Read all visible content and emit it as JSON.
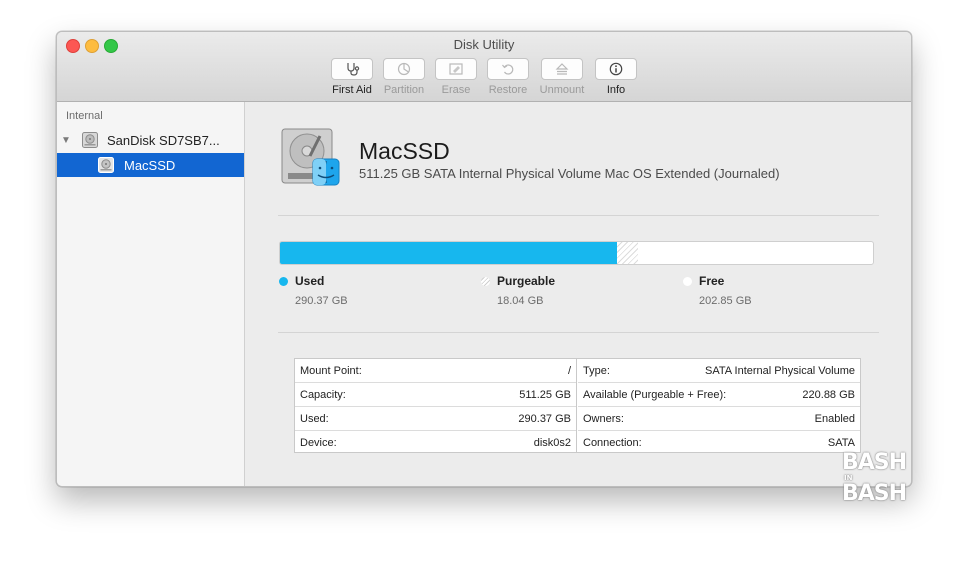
{
  "window": {
    "title": "Disk Utility"
  },
  "toolbar": {
    "first_aid": "First Aid",
    "partition": "Partition",
    "erase": "Erase",
    "restore": "Restore",
    "unmount": "Unmount",
    "info": "Info"
  },
  "sidebar": {
    "section": "Internal",
    "disk": "SanDisk SD7SB7...",
    "volume": "MacSSD"
  },
  "volume": {
    "name": "MacSSD",
    "description": "511.25 GB SATA Internal Physical Volume Mac OS Extended (Journaled)"
  },
  "usage": {
    "capacity_gb": 511.25,
    "used_gb": 290.37,
    "purgeable_gb": 18.04,
    "free_gb": 202.85,
    "colors": {
      "used": "#17b7ee",
      "purgeable": "#dcdcdc",
      "free": "#ffffff"
    },
    "legend": {
      "used_label": "Used",
      "used_value": "290.37 GB",
      "purgeable_label": "Purgeable",
      "purgeable_value": "18.04 GB",
      "free_label": "Free",
      "free_value": "202.85 GB"
    }
  },
  "info_left": [
    {
      "label": "Mount Point:",
      "value": "/"
    },
    {
      "label": "Capacity:",
      "value": "511.25 GB"
    },
    {
      "label": "Used:",
      "value": "290.37 GB"
    },
    {
      "label": "Device:",
      "value": "disk0s2"
    }
  ],
  "info_right": [
    {
      "label": "Type:",
      "value": "SATA Internal Physical Volume"
    },
    {
      "label": "Available (Purgeable + Free):",
      "value": "220.88 GB"
    },
    {
      "label": "Owners:",
      "value": "Enabled"
    },
    {
      "label": "Connection:",
      "value": "SATA"
    }
  ],
  "watermark": {
    "top": "BASH",
    "middle": "IN",
    "bottom": "BASH"
  }
}
